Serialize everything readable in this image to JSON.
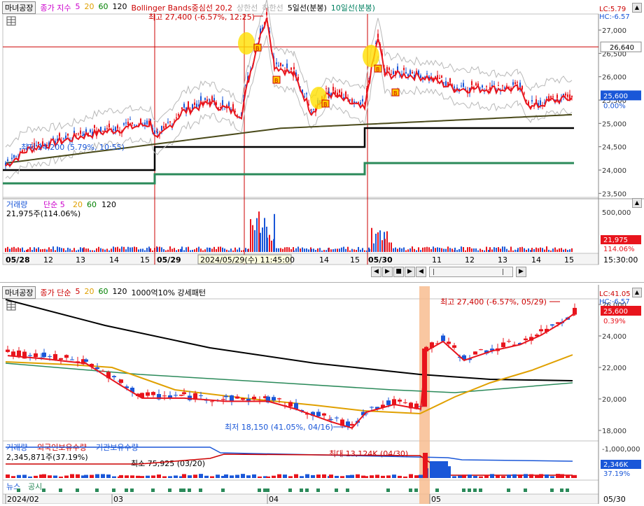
{
  "top_chart": {
    "stock_name": "마녀공장",
    "legend": [
      {
        "text": "종가 지수",
        "color": "#cc00cc"
      },
      {
        "text": "5",
        "color": "#cc00cc"
      },
      {
        "text": "20",
        "color": "#e0a000"
      },
      {
        "text": "60",
        "color": "#008000"
      },
      {
        "text": "120",
        "color": "#000000"
      },
      {
        "text": "Bollinger Bands중심선 20,2",
        "color": "#cc0000"
      },
      {
        "text": "상한선",
        "color": "#b0b0b0"
      },
      {
        "text": "하한선",
        "color": "#b0b0b0"
      },
      {
        "text": "5일선(분봉)",
        "color": "#000000"
      },
      {
        "text": "10일선(분봉)",
        "color": "#008060"
      }
    ],
    "high_label": "최고 27,400 (-6.57%, 12:25)",
    "low_label": "최저 24,200 (5.79%, 10:55)",
    "lc": "LC:5.79",
    "hc": "HC:-6.57",
    "ref_price": "26,640",
    "price_ticks": [
      "27,000",
      "26,500",
      "26,000",
      "25,500",
      "25,000",
      "24,500",
      "24,000",
      "23,500"
    ],
    "current_price": "25,600",
    "current_pct": "0.00%",
    "volume_legend": {
      "label": "거래량",
      "items": [
        "단순 5",
        "20",
        "60",
        "120"
      ],
      "value": "21,975주(114.06%)"
    },
    "volume_ticks": [
      "500,000"
    ],
    "volume_current": "21,975",
    "volume_pct": "114.06%",
    "date_ticks": [
      {
        "t": "05/28",
        "bold": true
      },
      {
        "t": "12"
      },
      {
        "t": "13"
      },
      {
        "t": "14"
      },
      {
        "t": "15"
      },
      {
        "t": "05/29",
        "bold": true
      },
      {
        "t": "14"
      },
      {
        "t": "15"
      },
      {
        "t": "05/30",
        "bold": true
      },
      {
        "t": "11"
      },
      {
        "t": "12"
      },
      {
        "t": "13"
      },
      {
        "t": "14"
      },
      {
        "t": "15"
      }
    ],
    "cursor_label": "2024/05/29(수) 11:45:00",
    "time_label": "15:30:00",
    "toolbar": [
      "◀",
      "▶",
      "■",
      "▶",
      "◀"
    ]
  },
  "bottom_chart": {
    "stock_name": "마녀공장",
    "legend": [
      {
        "text": "종가 단순",
        "color": "#cc0000"
      },
      {
        "text": "5",
        "color": "#cc0000"
      },
      {
        "text": "20",
        "color": "#e0a000"
      },
      {
        "text": "60",
        "color": "#008000"
      },
      {
        "text": "120",
        "color": "#000000"
      },
      {
        "text": "1000억10% 강세패턴",
        "color": "#000000"
      }
    ],
    "high_label": "최고 27,400 (-6.57%, 05/29)",
    "low_label": "최저 18,150 (41.05%, 04/16)",
    "lc": "LC:41.05",
    "hc": "HC:-6.57",
    "price_ticks": [
      "26,000",
      "24,000",
      "22,000",
      "20,000",
      "18,000"
    ],
    "current_price": "25,600",
    "current_pct": "0.39%",
    "volume_legend": {
      "items": [
        {
          "text": "거래량",
          "color": "#1a57d8"
        },
        {
          "text": "외국인보유수량",
          "color": "#cc0000"
        },
        {
          "text": "기관보유수량",
          "color": "#1a57d8"
        }
      ],
      "value": "2,345,871주(37.19%)"
    },
    "vol_min_label": "최소 75,925 (03/20)",
    "vol_max_label": "최대 13,124K (04/30)",
    "volume_ticks": [
      "-1,000,000"
    ],
    "volume_current": "2,346K",
    "volume_pct": "37.19%",
    "news_legend": [
      "뉴스",
      "공시"
    ],
    "date_ticks": [
      "2024/02",
      "03",
      "04",
      "05"
    ],
    "right_date": "05/30"
  },
  "colors": {
    "up": "#e8141c",
    "down": "#1a57d8",
    "accent": "#cc0000",
    "highlight": "#f7b98a"
  }
}
